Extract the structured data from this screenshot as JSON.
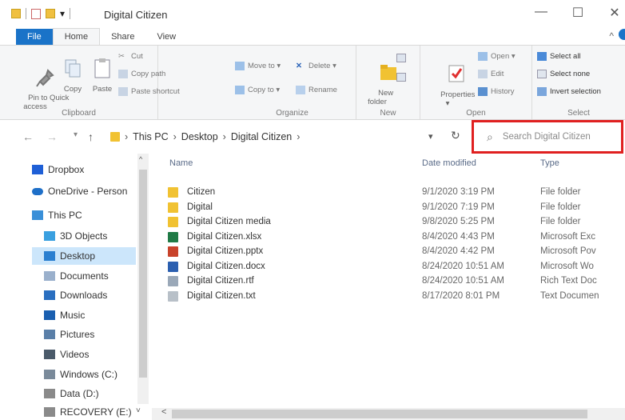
{
  "window": {
    "title": "Digital Citizen",
    "minimize": "—",
    "maximize": "☐",
    "close": "✕",
    "collapse_ribbon": "^"
  },
  "qat": {
    "dropdown": "▾"
  },
  "ribbon_tabs": [
    "File",
    "Home",
    "Share",
    "View"
  ],
  "ribbon": {
    "clipboard": {
      "label": "Clipboard",
      "pin": "Pin to Quick\naccess",
      "copy": "Copy",
      "paste": "Paste",
      "cut": "Cut",
      "copy_path": "Copy path",
      "paste_shortcut": "Paste shortcut"
    },
    "organize": {
      "label": "Organize",
      "move_to": "Move to ▾",
      "copy_to": "Copy to ▾",
      "delete": "Delete ▾",
      "rename": "Rename"
    },
    "new": {
      "label": "New",
      "new_folder": "New\nfolder"
    },
    "open": {
      "label": "Open",
      "properties": "Properties\n▾",
      "open": "Open ▾",
      "edit": "Edit",
      "history": "History"
    },
    "select": {
      "label": "Select",
      "select_all": "Select all",
      "select_none": "Select none",
      "invert": "Invert selection"
    }
  },
  "nav": {
    "back": "←",
    "forward": "→",
    "recent": "▾",
    "up": "↑"
  },
  "address": {
    "crumbs": [
      "This PC",
      "Desktop",
      "Digital Citizen"
    ],
    "sep": "›",
    "dropdown": "▾",
    "refresh": "↻"
  },
  "search": {
    "placeholder": "Search Digital Citizen",
    "icon": "⌕"
  },
  "nav_pane": [
    {
      "label": "Dropbox",
      "icon": "dropbox-icon",
      "color": "#1e5fd6"
    },
    {
      "label": "OneDrive - Person",
      "icon": "cloud-icon",
      "color": "#1e6fc8"
    },
    {
      "label": "This PC",
      "icon": "computer-icon",
      "color": "#3a8fd8"
    },
    {
      "label": "3D Objects",
      "icon": "cube-icon",
      "color": "#3aa0e0"
    },
    {
      "label": "Desktop",
      "icon": "desktop-icon",
      "color": "#2b7fd0"
    },
    {
      "label": "Documents",
      "icon": "document-icon",
      "color": "#9ab0cc"
    },
    {
      "label": "Downloads",
      "icon": "download-icon",
      "color": "#2a6fc0"
    },
    {
      "label": "Music",
      "icon": "music-icon",
      "color": "#1a5fb0"
    },
    {
      "label": "Pictures",
      "icon": "pictures-icon",
      "color": "#5a7fa8"
    },
    {
      "label": "Videos",
      "icon": "videos-icon",
      "color": "#4a5a6a"
    },
    {
      "label": "Windows (C:)",
      "icon": "drive-icon",
      "color": "#7a8a9a"
    },
    {
      "label": "Data (D:)",
      "icon": "drive-icon",
      "color": "#8a8a8a"
    },
    {
      "label": "RECOVERY (E:)",
      "icon": "drive-icon",
      "color": "#8a8a8a"
    }
  ],
  "nav_pane_scroll": {
    "up": "^",
    "down": "˅"
  },
  "columns": {
    "name": "Name",
    "date": "Date modified",
    "type": "Type"
  },
  "files": [
    {
      "name": "Citizen",
      "date": "9/1/2020 3:19 PM",
      "type": "File folder",
      "icon": "folder-icon",
      "color": "#f1c232"
    },
    {
      "name": "Digital",
      "date": "9/1/2020 7:19 PM",
      "type": "File folder",
      "icon": "folder-icon",
      "color": "#f1c232"
    },
    {
      "name": "Digital Citizen media",
      "date": "9/8/2020 5:25 PM",
      "type": "File folder",
      "icon": "folder-icon",
      "color": "#f1c232"
    },
    {
      "name": "Digital Citizen.xlsx",
      "date": "8/4/2020 4:43 PM",
      "type": "Microsoft Exc",
      "icon": "excel-icon",
      "color": "#1f7a45"
    },
    {
      "name": "Digital Citizen.pptx",
      "date": "8/4/2020 4:42 PM",
      "type": "Microsoft Pov",
      "icon": "powerpoint-icon",
      "color": "#c8432b"
    },
    {
      "name": "Digital Citizen.docx",
      "date": "8/24/2020 10:51 AM",
      "type": "Microsoft Wo",
      "icon": "word-icon",
      "color": "#2b5fb0"
    },
    {
      "name": "Digital Citizen.rtf",
      "date": "8/24/2020 10:51 AM",
      "type": "Rich Text Doc",
      "icon": "rtf-icon",
      "color": "#9aa8b8"
    },
    {
      "name": "Digital Citizen.txt",
      "date": "8/17/2020 8:01 PM",
      "type": "Text Documen",
      "icon": "text-file-icon",
      "color": "#b8c0c8"
    }
  ],
  "hscroll": {
    "left": "<"
  }
}
